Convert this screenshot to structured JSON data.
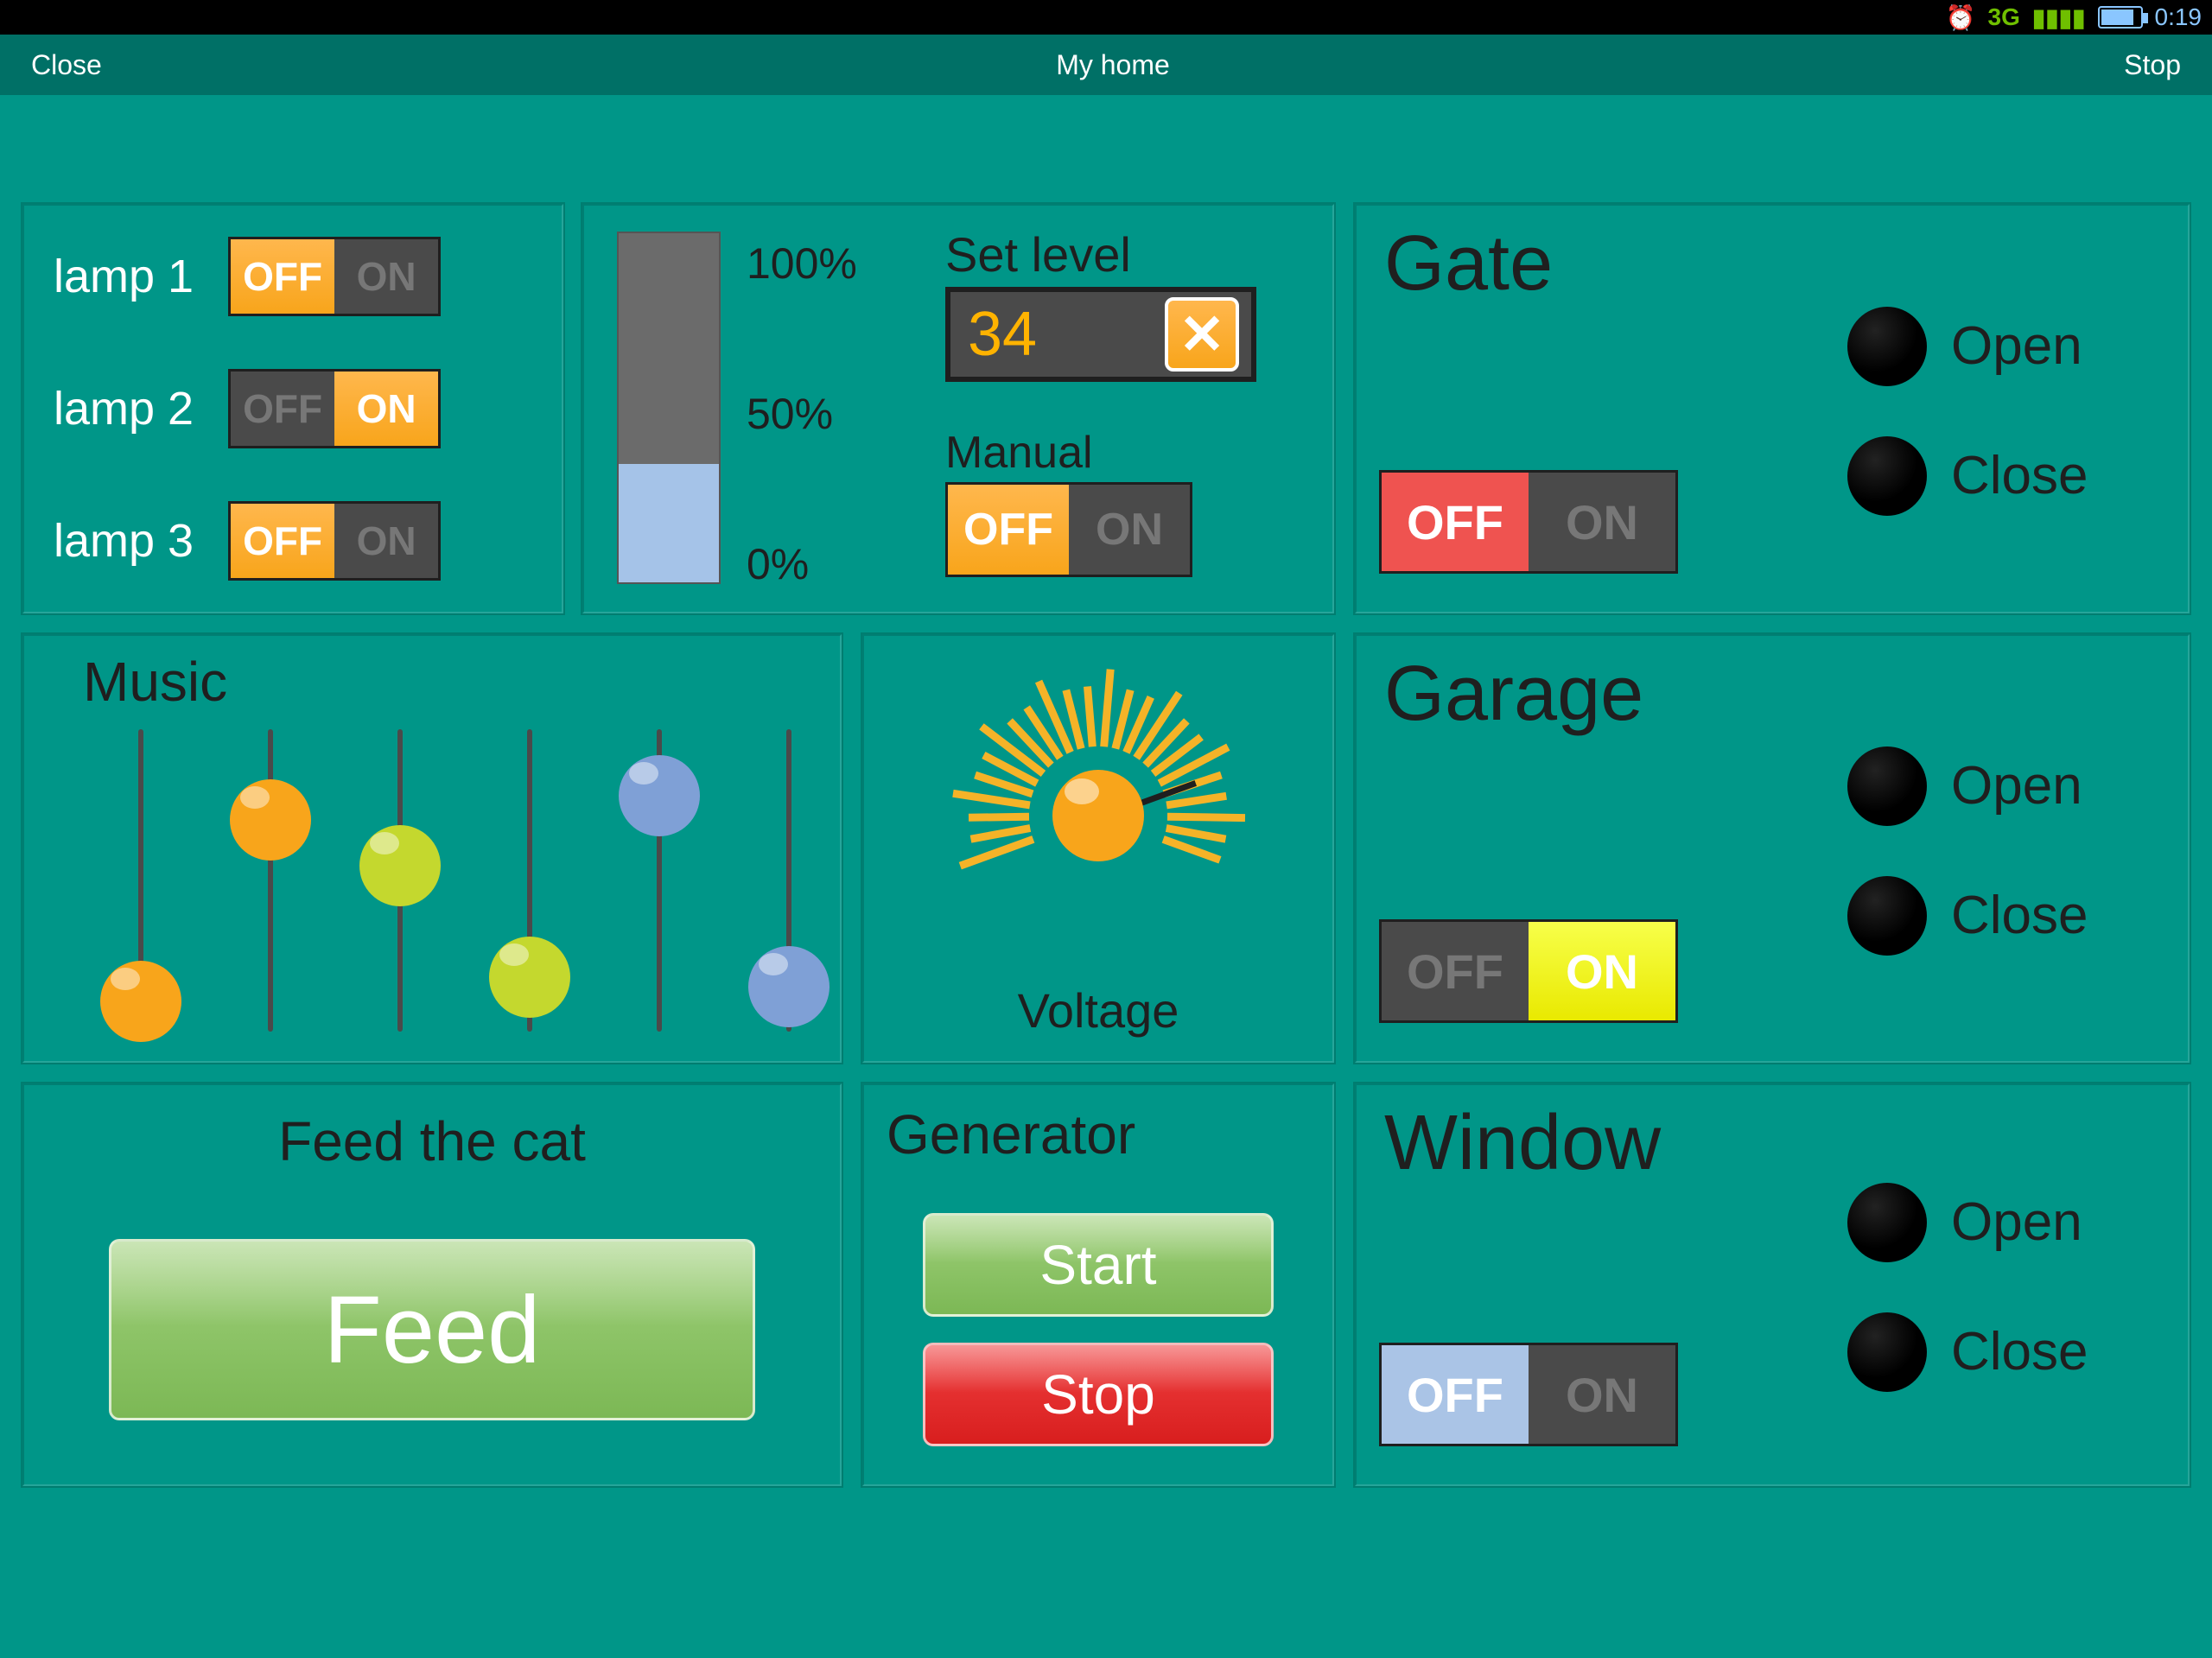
{
  "statusbar": {
    "network": "3G",
    "time": "0:19"
  },
  "titlebar": {
    "left": "Close",
    "title": "My home",
    "right": "Stop"
  },
  "lamps": {
    "items": [
      {
        "label": "lamp 1",
        "off": "OFF",
        "on": "ON",
        "state": "OFF"
      },
      {
        "label": "lamp 2",
        "off": "OFF",
        "on": "ON",
        "state": "ON"
      },
      {
        "label": "lamp 3",
        "off": "OFF",
        "on": "ON",
        "state": "OFF"
      }
    ]
  },
  "level": {
    "ticks": {
      "t100": "100%",
      "t50": "50%",
      "t0": "0%"
    },
    "fill_percent": 34,
    "set_label": "Set level",
    "set_value": "34",
    "x_label": "✕",
    "manual_label": "Manual",
    "manual": {
      "off": "OFF",
      "on": "ON",
      "state": "OFF"
    }
  },
  "music": {
    "title": "Music",
    "sliders": [
      {
        "value": 10,
        "color": "orange"
      },
      {
        "value": 70,
        "color": "orange"
      },
      {
        "value": 55,
        "color": "lime"
      },
      {
        "value": 18,
        "color": "lime"
      },
      {
        "value": 78,
        "color": "blue"
      },
      {
        "value": 15,
        "color": "blue"
      }
    ]
  },
  "voltage": {
    "title": "Voltage",
    "angle_deg": -20
  },
  "feed": {
    "title": "Feed the cat",
    "button": "Feed"
  },
  "generator": {
    "title": "Generator",
    "start": "Start",
    "stop": "Stop"
  },
  "gate": {
    "title": "Gate",
    "off": "OFF",
    "on": "ON",
    "state": "OFF",
    "open": "Open",
    "close": "Close",
    "toggle_color": "red"
  },
  "garage": {
    "title": "Garage",
    "off": "OFF",
    "on": "ON",
    "state": "ON",
    "open": "Open",
    "close": "Close",
    "toggle_color": "yellow"
  },
  "window": {
    "title": "Window",
    "off": "OFF",
    "on": "ON",
    "state": "OFF",
    "open": "Open",
    "close": "Close",
    "toggle_color": "blue"
  }
}
